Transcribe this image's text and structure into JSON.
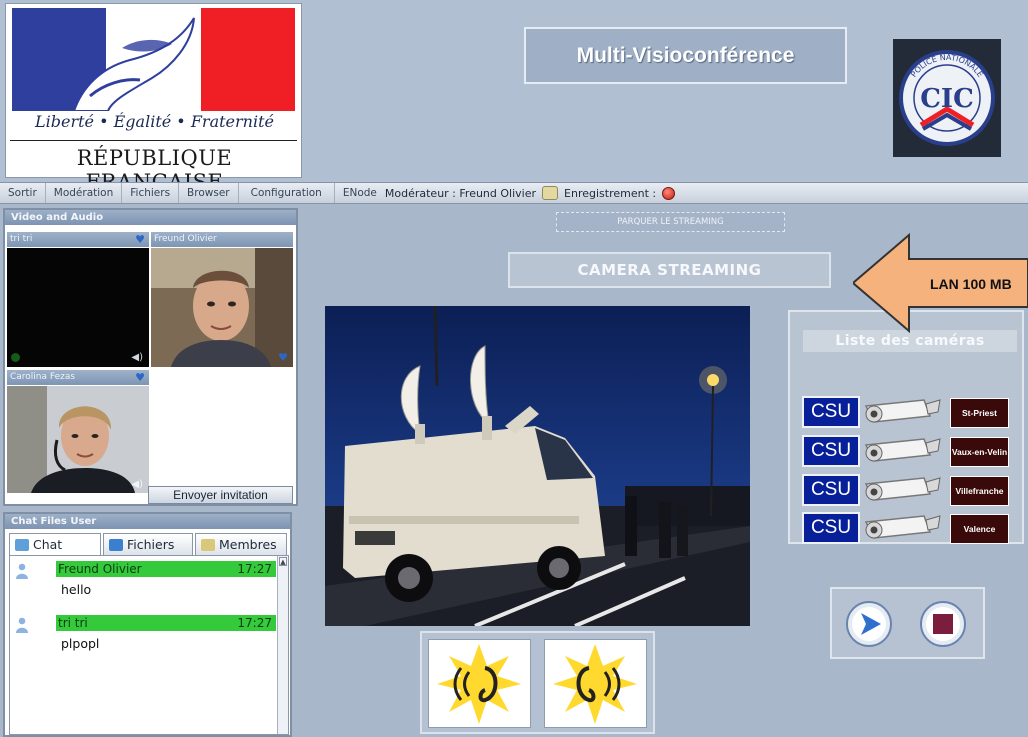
{
  "logo": {
    "motto": "Liberté • Égalité • Fraternité",
    "country": "RÉPUBLIQUE FRANÇAISE"
  },
  "app": {
    "title": "Multi-Visioconférence"
  },
  "badge": {
    "text_top": "POLICE NATIONALE",
    "text_center": "CIC"
  },
  "menu": {
    "items": [
      "Sortir",
      "Modération",
      "Fichiers",
      "Browser",
      "Configuration",
      "ENode"
    ],
    "moderator": "Modérateur : Freund Olivier",
    "recording_label": "Enregistrement :"
  },
  "video_panel": {
    "title": "Video and Audio",
    "tiles": [
      {
        "name": "tri tri"
      },
      {
        "name": "Freund Olivier"
      },
      {
        "name": "Carolina Fezas"
      }
    ],
    "invite_label": "Envoyer invitation"
  },
  "chat_panel": {
    "title": "Chat Files User",
    "tabs": [
      "Chat",
      "Fichiers",
      "Membres"
    ],
    "messages": [
      {
        "user": "Freund Olivier",
        "time": "17:27",
        "text": "hello"
      },
      {
        "user": "tri tri",
        "time": "17:27",
        "text": "plpopl"
      }
    ]
  },
  "stream": {
    "park_label": "PARQUER LE STREAMING",
    "title": "CAMERA STREAMING"
  },
  "cameras": {
    "title": "Liste des caméras",
    "items": [
      {
        "badge": "CSU",
        "city": "St-Priest"
      },
      {
        "badge": "CSU",
        "city": "Vaux-en-Velin"
      },
      {
        "badge": "CSU",
        "city": "Villefranche"
      },
      {
        "badge": "CSU",
        "city": "Valence"
      }
    ]
  },
  "annotation": {
    "text": "LAN 100 MB"
  },
  "icons": [
    "heart-icon",
    "user-icon",
    "folder-icon",
    "members-icon",
    "ear-icon",
    "play-icon",
    "stop-icon",
    "camera-icon",
    "record-icon"
  ],
  "colors": {
    "background": "#a9b7cb",
    "chat_highlight": "#35c93c",
    "csu_blue": "#07209a",
    "city_red": "#3a0a0a",
    "arrow_fill": "#f6b27c"
  }
}
